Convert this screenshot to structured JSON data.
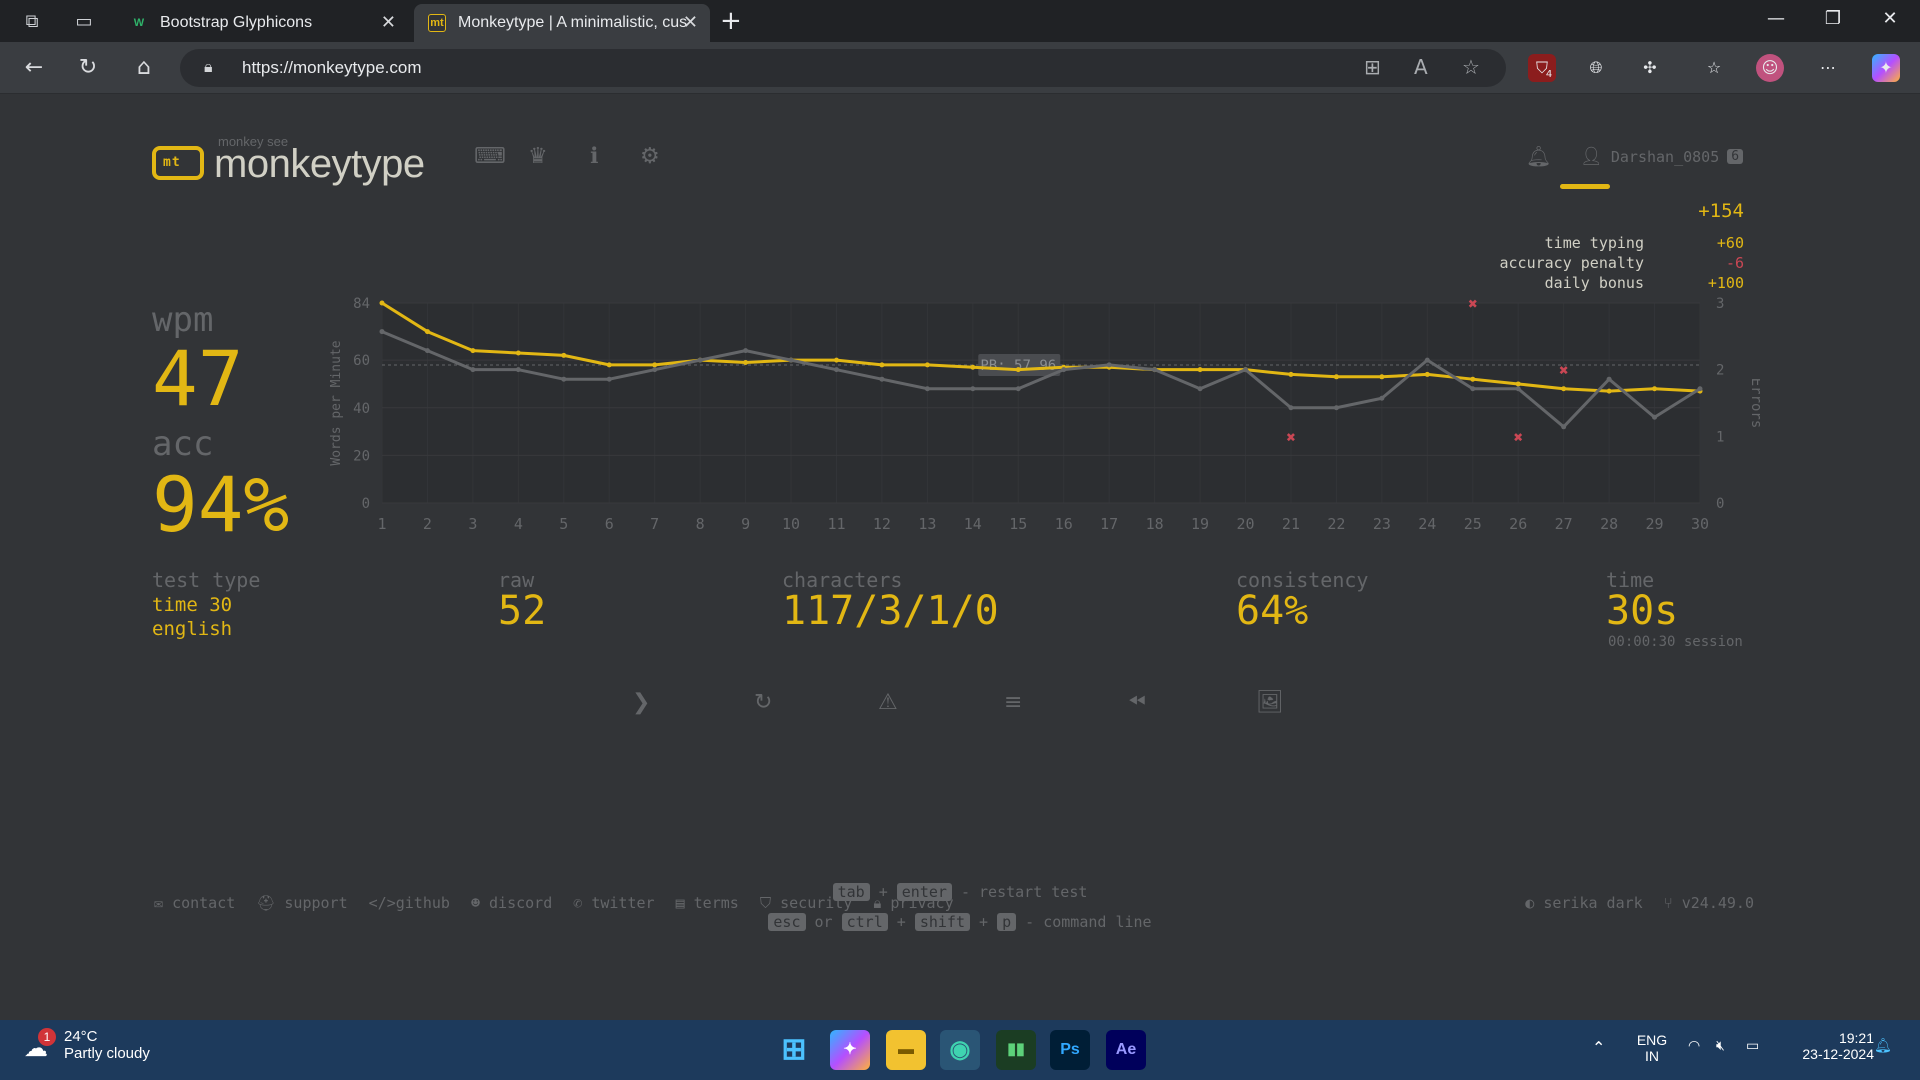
{
  "browser": {
    "tabs": [
      {
        "title": "Bootstrap Glyphicons",
        "favicon": "W"
      },
      {
        "title": "Monkeytype | A minimalistic, customizable typing test",
        "favicon": "mt"
      }
    ],
    "url": "https://monkeytype.com",
    "extension_badge": "4"
  },
  "header": {
    "logo_small": "monkey see",
    "logo_text": "monkeytype",
    "logo_icon_text": "mt",
    "username": "Darshan_0805",
    "level": "6"
  },
  "xp": {
    "total": "+154",
    "rows": [
      {
        "label": "time typing",
        "value": "+60",
        "color": "#e2b714"
      },
      {
        "label": "accuracy penalty",
        "value": "-6",
        "color": "#ca4754"
      },
      {
        "label": "daily bonus",
        "value": "+100",
        "color": "#e2b714"
      }
    ]
  },
  "stats": {
    "wpm_label": "wpm",
    "wpm": "47",
    "acc_label": "acc",
    "acc": "94%",
    "test_type_label": "test type",
    "test_type_mode": "time 30",
    "test_type_lang": "english",
    "raw_label": "raw",
    "raw": "52",
    "characters_label": "characters",
    "characters": "117/3/1/0",
    "consistency_label": "consistency",
    "consistency": "64%",
    "time_label": "time",
    "time": "30s",
    "session": "00:00:30 session"
  },
  "chart_data": {
    "type": "line",
    "x": [
      1,
      2,
      3,
      4,
      5,
      6,
      7,
      8,
      9,
      10,
      11,
      12,
      13,
      14,
      15,
      16,
      17,
      18,
      19,
      20,
      21,
      22,
      23,
      24,
      25,
      26,
      27,
      28,
      29,
      30
    ],
    "series": [
      {
        "name": "wpm",
        "values": [
          84,
          72,
          64,
          63,
          62,
          58,
          58,
          60,
          59,
          60,
          60,
          58,
          58,
          57,
          56,
          57,
          57,
          56,
          56,
          56,
          54,
          53,
          53,
          54,
          52,
          50,
          48,
          47,
          48,
          47
        ]
      },
      {
        "name": "raw",
        "values": [
          72,
          64,
          56,
          56,
          52,
          52,
          56,
          60,
          64,
          60,
          56,
          52,
          48,
          48,
          48,
          56,
          58,
          56,
          48,
          56,
          40,
          40,
          44,
          60,
          48,
          48,
          32,
          52,
          36,
          48
        ]
      }
    ],
    "errors": [
      {
        "x": 21,
        "y": 1
      },
      {
        "x": 25,
        "y": 3
      },
      {
        "x": 26,
        "y": 1
      },
      {
        "x": 27,
        "y": 2
      }
    ],
    "pb": 57.96,
    "pb_label": "PB: 57.96",
    "ylabel": "Words per Minute",
    "y2label": "Errors",
    "yticks": [
      "0",
      "20",
      "40",
      "60",
      "84"
    ],
    "ylim": [
      0,
      84
    ],
    "y2ticks": [
      "0",
      "1",
      "2",
      "3"
    ],
    "y2lim": [
      0,
      3
    ],
    "colors": {
      "wpm": "#e2b714",
      "raw": "#646669",
      "error": "#ca4754"
    }
  },
  "hints": {
    "line1": {
      "k1": "tab",
      "plus": "+",
      "k2": "enter",
      "text": "- restart test"
    },
    "line2": {
      "k1": "esc",
      "or": "or",
      "k2": "ctrl",
      "k3": "shift",
      "k4": "p",
      "text": "- command line"
    }
  },
  "footer": {
    "links": [
      "contact",
      "support",
      "github",
      "discord",
      "twitter",
      "terms",
      "security",
      "privacy"
    ],
    "theme": "serika dark",
    "version": "v24.49.0"
  },
  "taskbar": {
    "temp": "24°C",
    "weather": "Partly cloudy",
    "weather_badge": "1",
    "lang1": "ENG",
    "lang2": "IN",
    "time": "19:21",
    "date": "23-12-2024"
  }
}
